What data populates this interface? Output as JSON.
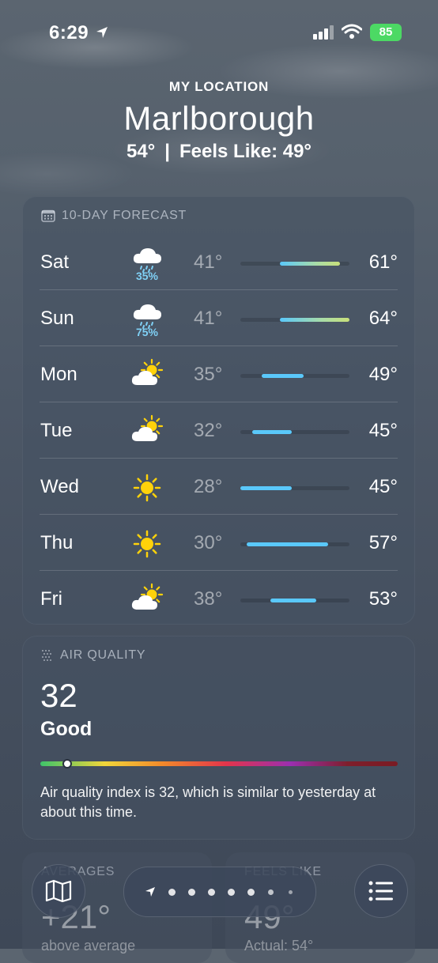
{
  "status_bar": {
    "time": "6:29",
    "battery": "85"
  },
  "header": {
    "location_label": "MY LOCATION",
    "city": "Marlborough",
    "current_temp": "54°",
    "separator": "|",
    "feels_like": "Feels Like: 49°"
  },
  "forecast": {
    "title": "10-DAY FORECAST",
    "range_min": 28,
    "range_max": 64,
    "days": [
      {
        "day": "Sat",
        "icon": "cloud-rain-icon",
        "precip": "35%",
        "low": "41°",
        "high": "61°",
        "low_val": 41,
        "high_val": 61
      },
      {
        "day": "Sun",
        "icon": "cloud-rain-icon",
        "precip": "75%",
        "low": "41°",
        "high": "64°",
        "low_val": 41,
        "high_val": 64
      },
      {
        "day": "Mon",
        "icon": "partly-cloudy-icon",
        "precip": "",
        "low": "35°",
        "high": "49°",
        "low_val": 35,
        "high_val": 49
      },
      {
        "day": "Tue",
        "icon": "partly-cloudy-icon",
        "precip": "",
        "low": "32°",
        "high": "45°",
        "low_val": 32,
        "high_val": 45
      },
      {
        "day": "Wed",
        "icon": "sun-icon",
        "precip": "",
        "low": "28°",
        "high": "45°",
        "low_val": 28,
        "high_val": 45
      },
      {
        "day": "Thu",
        "icon": "sun-icon",
        "precip": "",
        "low": "30°",
        "high": "57°",
        "low_val": 30,
        "high_val": 57
      },
      {
        "day": "Fri",
        "icon": "partly-cloudy-icon",
        "precip": "",
        "low": "38°",
        "high": "53°",
        "low_val": 38,
        "high_val": 53
      }
    ]
  },
  "air_quality": {
    "title": "AIR QUALITY",
    "value": "32",
    "category": "Good",
    "scale_position": 0.07,
    "description": "Air quality index is 32, which is similar to yesterday at about this time."
  },
  "partial_cards": {
    "left": {
      "title": "AVERAGES",
      "big": "+21°",
      "small": "above average"
    },
    "right": {
      "title": "FEELS LIKE",
      "big": "49°",
      "small": "Actual: 54°"
    }
  },
  "pager": {
    "page_count": 7,
    "active_index": 0
  },
  "colors": {
    "bar_cool": "#5ac8fa",
    "bar_mild": "#a8dca8",
    "precip": "#7fd0f5",
    "sun": "#ffd20a"
  }
}
